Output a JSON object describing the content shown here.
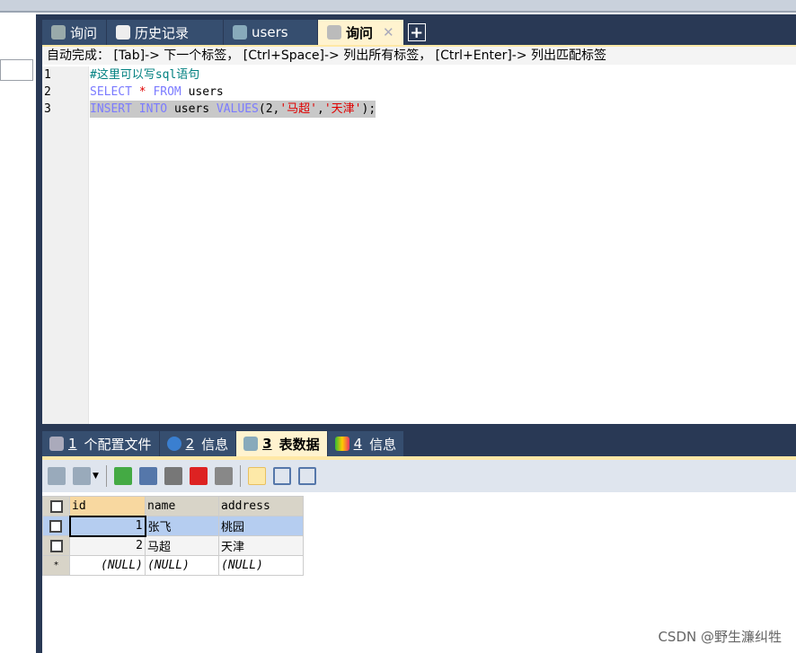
{
  "tabs": [
    {
      "label": "询问",
      "icon": "query-icon"
    },
    {
      "label": "历史记录",
      "icon": "calendar-icon"
    },
    {
      "label": "users",
      "icon": "table-icon"
    },
    {
      "label": "询问",
      "icon": "query-icon",
      "active": true
    }
  ],
  "hint": "自动完成： [Tab]-> 下一个标签， [Ctrl+Space]-> 列出所有标签， [Ctrl+Enter]-> 列出匹配标签",
  "code": {
    "l1": "#这里可以写sql语句",
    "l2_kw1": "SELECT",
    "l2_star": "*",
    "l2_kw2": "FROM",
    "l2_rest": "users",
    "l3_kw1": "INSERT",
    "l3_kw2": "INTO",
    "l3_t": "users",
    "l3_kw3": "VALUES",
    "l3_a": "(2,",
    "l3_s1": "'马超'",
    "l3_c": ",",
    "l3_s2": "'天津'",
    "l3_e": ");"
  },
  "line_numbers": [
    "1",
    "2",
    "3"
  ],
  "bottom_tabs": [
    {
      "num": "1",
      "label": "个配置文件"
    },
    {
      "num": "2",
      "label": "信息"
    },
    {
      "num": "3",
      "label": "表数据",
      "active": true
    },
    {
      "num": "4",
      "label": "信息"
    }
  ],
  "grid": {
    "columns": [
      "id",
      "name",
      "address"
    ],
    "rows": [
      [
        "1",
        "张飞",
        "桃园"
      ],
      [
        "2",
        "马超",
        "天津"
      ]
    ],
    "new_row": [
      "(NULL)",
      "(NULL)",
      "(NULL)"
    ],
    "new_marker": "*"
  },
  "watermark": "CSDN @野生濂纠牲"
}
